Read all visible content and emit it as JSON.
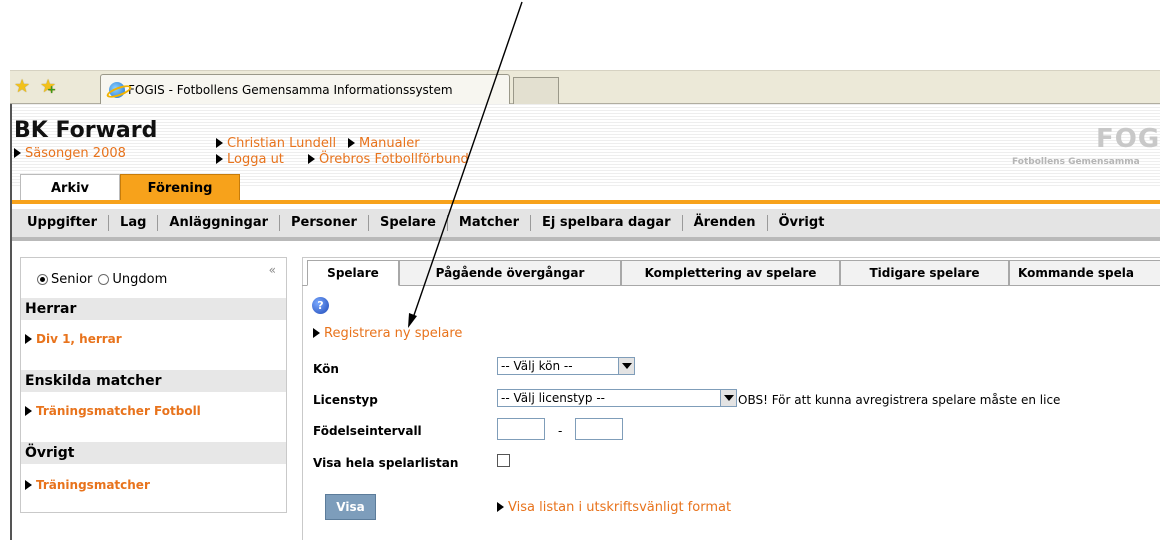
{
  "browser": {
    "tab_title": "FOGIS - Fotbollens Gemensamma Informationssystem"
  },
  "header": {
    "club_name": "BK Forward",
    "season_link": "Säsongen 2008",
    "user_link": "Christian Lundell",
    "manuals_link": "Manualer",
    "logout_link": "Logga ut",
    "district_link": "Örebros Fotbollförbund",
    "logo_text": "FOG",
    "logo_subtitle": "Fotbollens Gemensamma"
  },
  "main_tabs": [
    {
      "label": "Arkiv",
      "active": false
    },
    {
      "label": "Förening",
      "active": true
    }
  ],
  "nav": {
    "items": [
      "Uppgifter",
      "Lag",
      "Anläggningar",
      "Personer",
      "Spelare",
      "Matcher",
      "Ej spelbara dagar",
      "Ärenden",
      "Övrigt"
    ]
  },
  "sidebar": {
    "collapse_symbol": "«",
    "radio_senior": "Senior",
    "radio_youth": "Ungdom",
    "selected": "Senior",
    "sections": [
      {
        "title": "Herrar",
        "links": [
          "Div 1, herrar"
        ]
      },
      {
        "title": "Enskilda matcher",
        "links": [
          "Träningsmatcher Fotboll"
        ]
      },
      {
        "title": "Övrigt",
        "links": [
          "Träningsmatcher"
        ]
      }
    ]
  },
  "content_tabs": [
    "Spelare",
    "Pågående övergångar",
    "Komplettering av spelare",
    "Tidigare spelare",
    "Kommande spela"
  ],
  "active_content_tab": "Spelare",
  "form": {
    "help_symbol": "?",
    "register_link": "Registrera ny spelare",
    "gender_label": "Kön",
    "gender_select": "-- Välj kön --",
    "license_label": "Licenstyp",
    "license_select": "-- Välj licenstyp --",
    "license_note": "OBS! För att kunna avregistrera spelare måste en lice",
    "birth_label": "Födelseintervall",
    "range_separator": "-",
    "show_all_label": "Visa hela spelarlistan",
    "show_button": "Visa",
    "print_link": "Visa listan i utskriftsvänligt format"
  },
  "colors": {
    "accent_orange": "#f7a21b",
    "link_orange": "#e8731c",
    "button_blue": "#7d9dbb"
  }
}
